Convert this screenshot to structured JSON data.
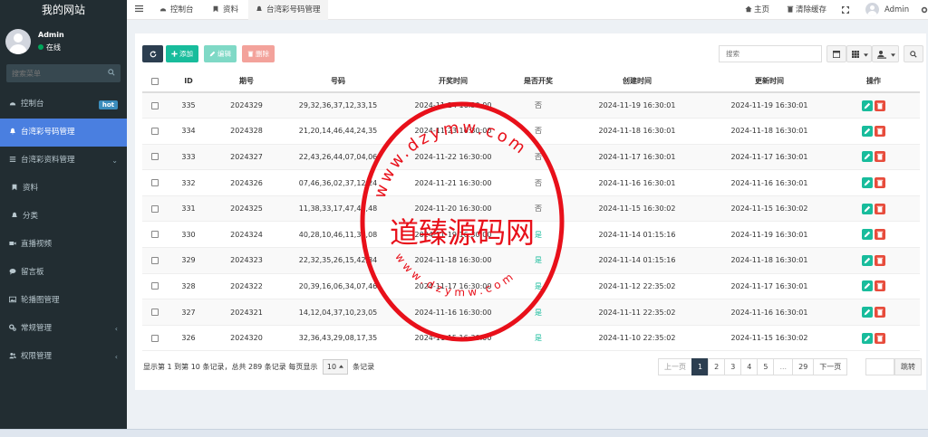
{
  "app": {
    "title": "我的网站",
    "user_name": "Admin",
    "user_status": "在线",
    "search_placeholder": "搜索菜单"
  },
  "sidebar": {
    "items": [
      {
        "label": "控制台",
        "icon": "dashboard-icon",
        "badge": "hot"
      },
      {
        "label": "台湾彩号码管理",
        "icon": "bell-icon",
        "active": true
      },
      {
        "label": "台湾彩资料管理",
        "icon": "list-icon",
        "chevron": "⌄"
      },
      {
        "label": "资料",
        "icon": "bookmark-icon",
        "sub": true
      },
      {
        "label": "分类",
        "icon": "bell-icon",
        "sub": true
      },
      {
        "label": "直播视频",
        "icon": "video-icon"
      },
      {
        "label": "留言板",
        "icon": "comment-icon"
      },
      {
        "label": "轮播图管理",
        "icon": "image-icon"
      },
      {
        "label": "常规管理",
        "icon": "cogs-icon",
        "chevron": "‹"
      },
      {
        "label": "权限管理",
        "icon": "users-icon",
        "chevron": "‹"
      }
    ]
  },
  "topbar": {
    "tabs": [
      {
        "label": "控制台"
      },
      {
        "label": "资料"
      },
      {
        "label": "台湾彩号码管理"
      }
    ],
    "home": "主页",
    "clear_cache": "清除缓存",
    "admin": "Admin"
  },
  "toolbar": {
    "add": "添加",
    "edit": "编辑",
    "delete": "删除",
    "search_placeholder": "搜索"
  },
  "table": {
    "headers": [
      "ID",
      "期号",
      "号码",
      "开奖时间",
      "是否开奖",
      "创建时间",
      "更新时间",
      "操作"
    ],
    "rows": [
      {
        "id": "335",
        "period": "2024329",
        "numbers": "29,32,36,37,12,33,15",
        "draw_time": "2024-11-24 16:30:00",
        "drawn": "否",
        "created": "2024-11-19 16:30:01",
        "updated": "2024-11-19 16:30:01"
      },
      {
        "id": "334",
        "period": "2024328",
        "numbers": "21,20,14,46,44,24,35",
        "draw_time": "2024-11-23 16:30:00",
        "drawn": "否",
        "created": "2024-11-18 16:30:01",
        "updated": "2024-11-18 16:30:01"
      },
      {
        "id": "333",
        "period": "2024327",
        "numbers": "22,43,26,44,07,04,06",
        "draw_time": "2024-11-22 16:30:00",
        "drawn": "否",
        "created": "2024-11-17 16:30:01",
        "updated": "2024-11-17 16:30:01"
      },
      {
        "id": "332",
        "period": "2024326",
        "numbers": "07,46,36,02,37,12,24",
        "draw_time": "2024-11-21 16:30:00",
        "drawn": "否",
        "created": "2024-11-16 16:30:01",
        "updated": "2024-11-16 16:30:01"
      },
      {
        "id": "331",
        "period": "2024325",
        "numbers": "11,38,33,17,47,41,48",
        "draw_time": "2024-11-20 16:30:00",
        "drawn": "否",
        "created": "2024-11-15 16:30:02",
        "updated": "2024-11-15 16:30:02"
      },
      {
        "id": "330",
        "period": "2024324",
        "numbers": "40,28,10,46,11,34,08",
        "draw_time": "2024-11-19 16:30:00",
        "drawn": "是",
        "created": "2024-11-14 01:15:16",
        "updated": "2024-11-19 16:30:01"
      },
      {
        "id": "329",
        "period": "2024323",
        "numbers": "22,32,35,26,15,42,34",
        "draw_time": "2024-11-18 16:30:00",
        "drawn": "是",
        "created": "2024-11-14 01:15:16",
        "updated": "2024-11-18 16:30:01"
      },
      {
        "id": "328",
        "period": "2024322",
        "numbers": "20,39,16,06,34,07,46",
        "draw_time": "2024-11-17 16:30:00",
        "drawn": "是",
        "created": "2024-11-12 22:35:02",
        "updated": "2024-11-17 16:30:01"
      },
      {
        "id": "327",
        "period": "2024321",
        "numbers": "14,12,04,37,10,23,05",
        "draw_time": "2024-11-16 16:30:00",
        "drawn": "是",
        "created": "2024-11-11 22:35:02",
        "updated": "2024-11-16 16:30:01"
      },
      {
        "id": "326",
        "period": "2024320",
        "numbers": "32,36,43,29,08,17,35",
        "draw_time": "2024-11-15 16:30:00",
        "drawn": "是",
        "created": "2024-11-10 22:35:02",
        "updated": "2024-11-15 16:30:02"
      }
    ]
  },
  "footer": {
    "info_prefix": "显示第 1 到第 10 条记录，总共 289 条记录 每页显示",
    "page_size": "10",
    "info_suffix": "条记录",
    "prev": "上一页",
    "next": "下一页",
    "pages": [
      "1",
      "2",
      "3",
      "4",
      "5",
      "...",
      "29"
    ],
    "jump": "跳转"
  },
  "watermark": {
    "main": "道臻源码网",
    "top_arc": "www.dzymw.com",
    "bottom_arc": "www.dzymw.com",
    "color": "#e8101a"
  },
  "colors": {
    "sidebar_bg": "#222d32",
    "active": "#4a7fe0",
    "success": "#18bc9c",
    "danger": "#e74c3c"
  }
}
